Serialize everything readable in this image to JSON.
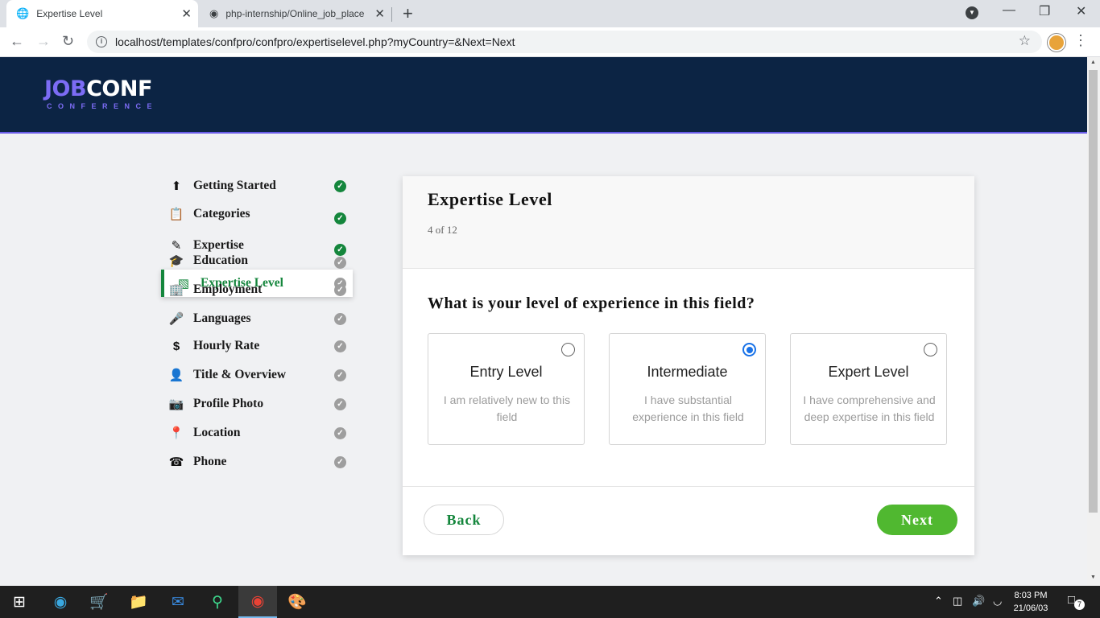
{
  "browser": {
    "tabs": [
      {
        "title": "Expertise Level"
      },
      {
        "title": "php-internship/Online_job_place"
      }
    ],
    "url": "localhost/templates/confpro/confpro/expertiselevel.php?myCountry=&Next=Next"
  },
  "header": {
    "logo_part1": "JOB",
    "logo_part2": "CONF",
    "logo_sub": "CONFERENCE"
  },
  "steps": [
    {
      "label": "Getting Started",
      "icon": "arrow-up-circle-icon",
      "status": "done"
    },
    {
      "label": "Categories",
      "icon": "clipboard-icon",
      "status": "done"
    },
    {
      "label": "Expertise",
      "icon": "pencil-icon",
      "status": "done"
    },
    {
      "label": "Expertise Level",
      "icon": "bar-chart-icon",
      "status": "active"
    },
    {
      "label": "Education",
      "icon": "graduation-cap-icon",
      "status": "todo"
    },
    {
      "label": "Employment",
      "icon": "building-icon",
      "status": "todo"
    },
    {
      "label": "Languages",
      "icon": "microphone-icon",
      "status": "todo"
    },
    {
      "label": "Hourly Rate",
      "icon": "dollar-icon",
      "status": "todo"
    },
    {
      "label": "Title & Overview",
      "icon": "user-tie-icon",
      "status": "todo"
    },
    {
      "label": "Profile Photo",
      "icon": "camera-icon",
      "status": "todo"
    },
    {
      "label": "Location",
      "icon": "map-pin-icon",
      "status": "todo"
    },
    {
      "label": "Phone",
      "icon": "phone-icon",
      "status": "todo"
    }
  ],
  "card": {
    "title": "Expertise Level",
    "progress": "4 of 12",
    "question": "What is your level of experience in this field?",
    "options": [
      {
        "title": "Entry Level",
        "desc": "I am relatively new to this field",
        "selected": false
      },
      {
        "title": "Intermediate",
        "desc": "I have substantial experience in this field",
        "selected": true
      },
      {
        "title": "Expert Level",
        "desc": "I have comprehensive and deep expertise in this field",
        "selected": false
      }
    ],
    "back_label": "Back",
    "next_label": "Next"
  },
  "taskbar": {
    "time": "8:03 PM",
    "date": "21/06/03",
    "notifications": "7"
  },
  "colors": {
    "header_bg": "#0c2444",
    "accent": "#7c6cf5",
    "green": "#14863c",
    "next_btn": "#50b830"
  }
}
